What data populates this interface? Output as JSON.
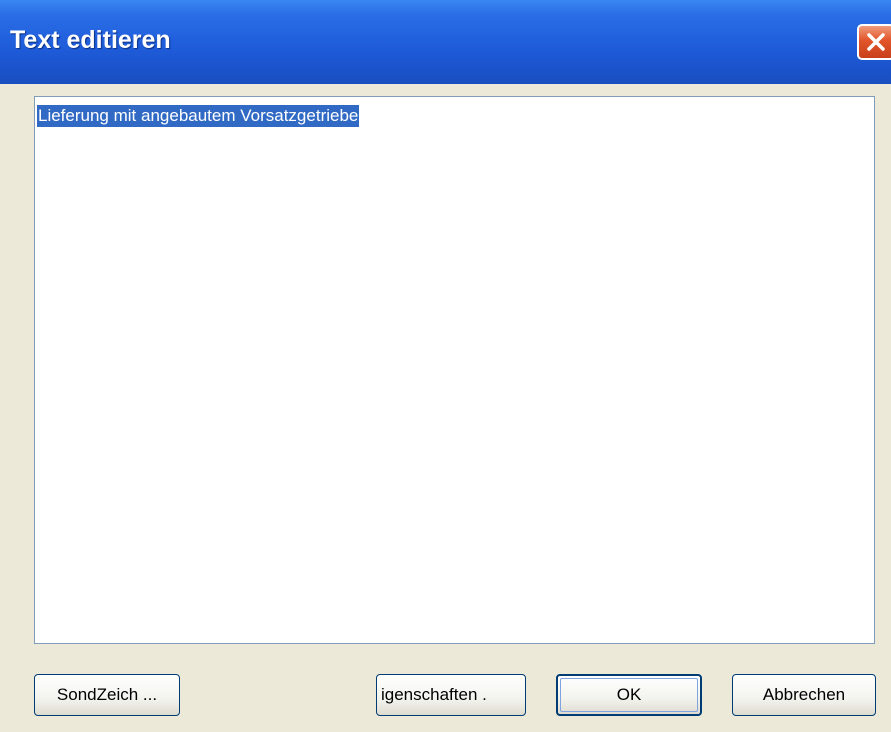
{
  "window": {
    "title": "Text editieren"
  },
  "editor": {
    "selected_text": "Lieferung mit angebautem Vorsatzgetriebe"
  },
  "buttons": {
    "special_chars": "SondZeich ...",
    "properties": "igenschaften .",
    "ok": "OK",
    "cancel": "Abbrechen"
  },
  "colors": {
    "titlebar_blue": "#2a6de6",
    "close_red": "#e2552a",
    "dialog_bg": "#ece9d8",
    "selection_bg": "#316ac5"
  }
}
